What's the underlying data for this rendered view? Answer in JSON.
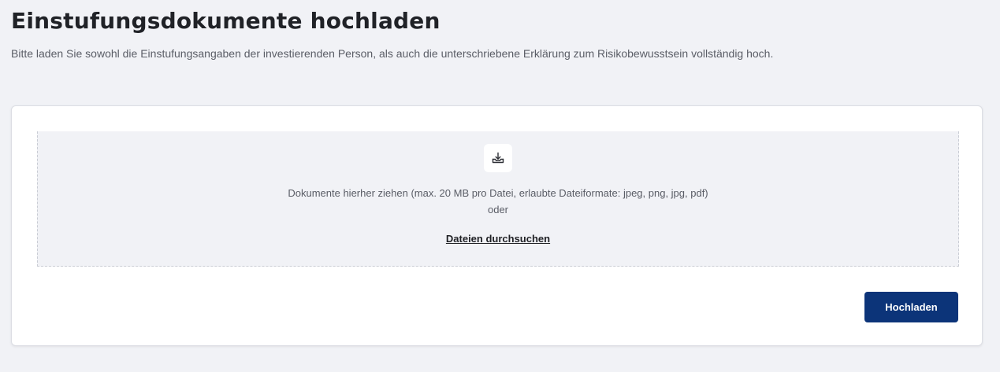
{
  "header": {
    "title": "Einstufungsdokumente hochladen",
    "subtitle": "Bitte laden Sie sowohl die Einstufungsangaben der investierenden Person, als auch die unterschriebene Erklärung zum Risikobewusstsein vollständig hoch."
  },
  "dropzone": {
    "icon": "upload-tray-icon",
    "instructions": "Dokumente hierher ziehen (max. 20 MB pro Datei, erlaubte Dateiformate: jpeg, png, jpg, pdf)",
    "or_label": "oder",
    "browse_label": "Dateien durchsuchen"
  },
  "actions": {
    "upload_label": "Hochladen"
  },
  "colors": {
    "background": "#f1f2f6",
    "card": "#ffffff",
    "primary_button": "#0c3479",
    "text_muted": "#5a5d66"
  }
}
